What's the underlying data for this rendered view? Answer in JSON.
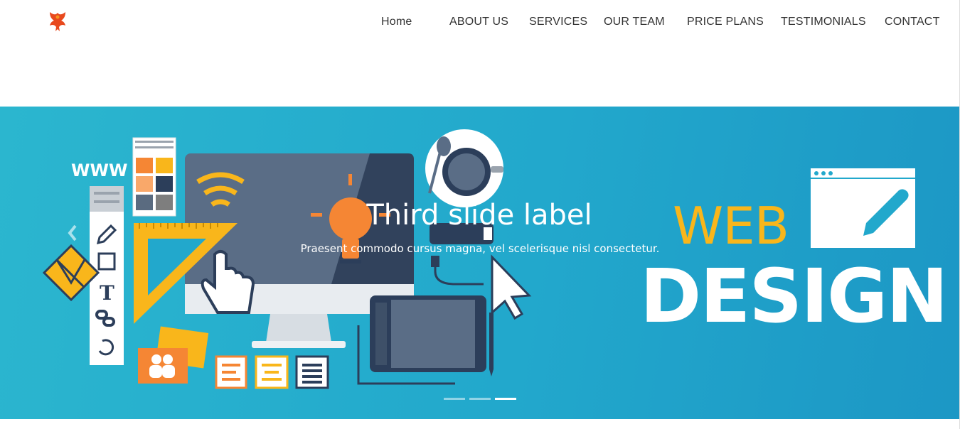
{
  "nav": {
    "items": [
      "Home",
      "ABOUT US",
      "SERVICES",
      "OUR TEAM",
      "PRICE PLANS",
      "TESTIMONIALS",
      "CONTACT"
    ]
  },
  "logo": {
    "icon": "phoenix-logo-icon",
    "color": "#e8491d"
  },
  "carousel": {
    "caption_title": "Third slide label",
    "caption_text": "Praesent commodo cursus magna, vel scelerisque nisl consectetur.",
    "active_slide": 3,
    "slide_count": 3,
    "illustration": {
      "www_text": "WWW",
      "web_text": "WEB",
      "design_text": "DESIGN"
    }
  },
  "colors": {
    "hero_bg": "#22a8cc",
    "accent_yellow": "#f9b61b",
    "accent_orange": "#f58634",
    "navy": "#2c3e5a"
  }
}
